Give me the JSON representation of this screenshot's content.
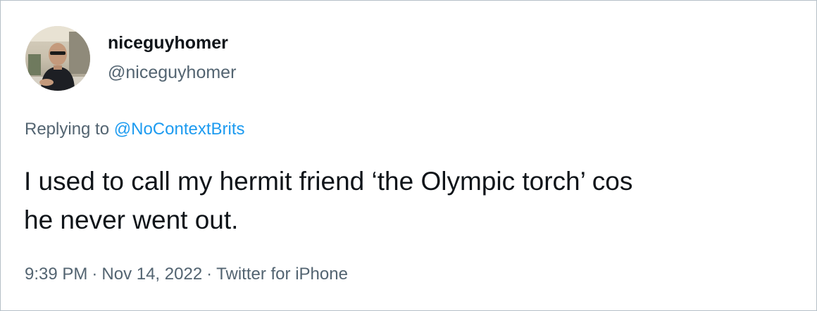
{
  "author": {
    "display_name": "niceguyhomer",
    "handle": "@niceguyhomer"
  },
  "reply": {
    "prefix": "Replying to",
    "mention": "@NoContextBrits"
  },
  "tweet": {
    "line1": "I used to call my hermit friend ‘the Olympic torch’ cos",
    "line2": "he never went out."
  },
  "meta": {
    "time": "9:39 PM",
    "separator": "·",
    "date": "Nov 14, 2022",
    "source": "Twitter for iPhone"
  },
  "colors": {
    "text": "#0f1419",
    "secondary": "#536471",
    "link": "#1d9bf0",
    "border": "#b5bfc7"
  }
}
